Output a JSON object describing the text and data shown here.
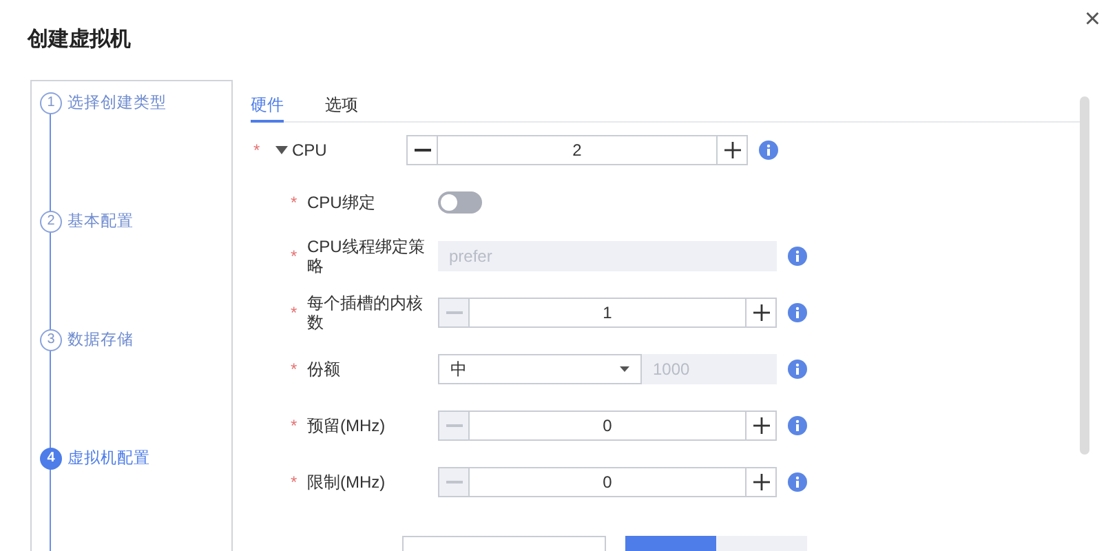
{
  "dialog": {
    "title": "创建虚拟机",
    "close": "×"
  },
  "steps": [
    {
      "number": "1",
      "label": "选择创建类型",
      "selected": false
    },
    {
      "number": "2",
      "label": "基本配置",
      "selected": false
    },
    {
      "number": "3",
      "label": "数据存储",
      "selected": false
    },
    {
      "number": "4",
      "label": "虚拟机配置",
      "selected": true
    }
  ],
  "tabs": [
    {
      "label": "硬件",
      "selected": true
    },
    {
      "label": "选项",
      "selected": false
    }
  ],
  "cpu": {
    "required_mark": "*",
    "label": "CPU",
    "expanded": true,
    "value": "2",
    "minus_disabled": false
  },
  "rows": [
    {
      "kind": "switch",
      "required_mark": "*",
      "label": "CPU绑定",
      "on": false
    },
    {
      "kind": "text",
      "required_mark": "*",
      "label": "CPU线程绑定策略",
      "placeholder": "prefer",
      "disabled": true
    },
    {
      "kind": "stepper",
      "required_mark": "*",
      "label": "每个插槽的内核数",
      "value": "1",
      "minus_disabled": true
    },
    {
      "kind": "select",
      "required_mark": "*",
      "label": "份额",
      "value": "中",
      "placeholder": "1000"
    },
    {
      "kind": "stepper",
      "required_mark": "*",
      "label": "预留(MHz)",
      "value": "0",
      "minus_disabled": true
    },
    {
      "kind": "stepper",
      "required_mark": "*",
      "label": "限制(MHz)",
      "value": "0",
      "minus_disabled": true
    },
    {
      "kind": "cutoff"
    }
  ]
}
